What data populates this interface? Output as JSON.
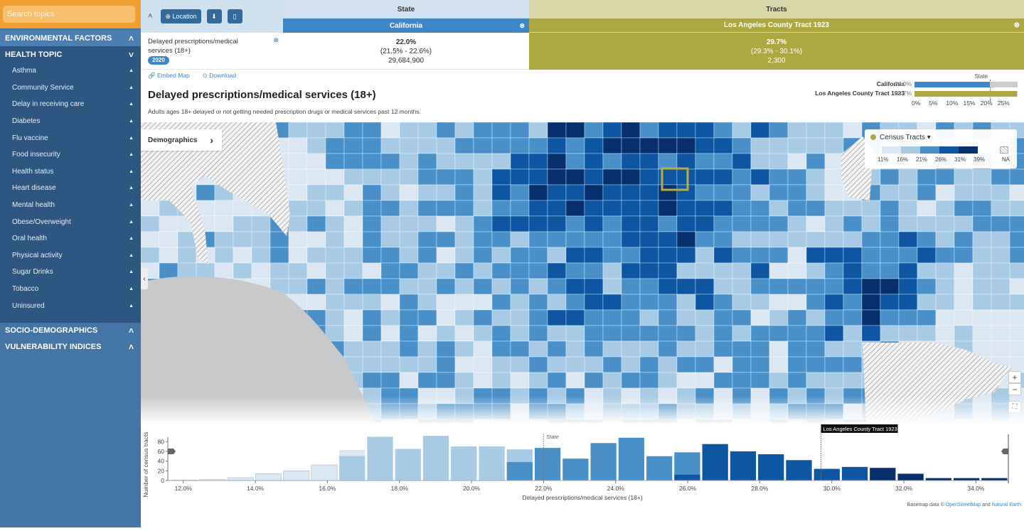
{
  "sidebar": {
    "search_placeholder": "Search topics",
    "sections": {
      "environmental": "ENVIRONMENTAL FACTORS",
      "health": "HEALTH TOPIC",
      "socio": "SOCIO-DEMOGRAPHICS",
      "vulnerability": "VULNERABILITY INDICES"
    },
    "topics": [
      "Asthma",
      "Community Service",
      "Delay in receiving care",
      "Diabetes",
      "Flu vaccine",
      "Food insecurity",
      "Health status",
      "Heart disease",
      "Mental health",
      "Obese/Overweight",
      "Oral health",
      "Physical activity",
      "Sugar Drinks",
      "Tobacco",
      "Uninsured"
    ],
    "chevron_up": "˄",
    "chevron_down": "˅"
  },
  "header": {
    "location_btn": "⊕ Location",
    "download_icon": "⬇",
    "bookmark_icon": "▯",
    "collapse_icon": "˄",
    "state_col": "State",
    "tracts_col": "Tracts",
    "state_name": "California",
    "tract_name": "Los Angeles County Tract 1923",
    "close_icon": "⊗",
    "indicator": "Delayed prescriptions/medical services (18+)",
    "year": "2020",
    "state_value": "22.0%",
    "state_ci": "(21.5% - 22.6%)",
    "state_pop": "29,684,900",
    "tract_value": "29.7%",
    "tract_ci": "(29.3% - 30.1%)",
    "tract_pop": "2,300"
  },
  "links": {
    "embed": "🔗 Embed Map",
    "download": "⊙ Download"
  },
  "title": "Delayed prescriptions/medical services (18+)",
  "subtitle": "Adults ages 18+ delayed or not getting needed prescription drugs or medical services past 12 months.",
  "comparison": {
    "state_label": "State",
    "rows": [
      {
        "name": "California",
        "value": 22.0,
        "display": "22.0%",
        "color": "#3f86c8"
      },
      {
        "name": "Los Angeles County Tract 1923",
        "value": 29.7,
        "display": "29.7%",
        "color": "#aea843"
      }
    ],
    "max": 30,
    "ticks": [
      "0%",
      "5%",
      "10%",
      "15%",
      "20%",
      "25%"
    ]
  },
  "map": {
    "demographics_btn": "Demographics",
    "chevron_right": "›",
    "collapse_left": "‹",
    "legend_title": "Census Tracts ▾",
    "legend_colors": [
      "#dbe7f3",
      "#a7cbe4",
      "#4a90c8",
      "#0e56a1",
      "#072f6b"
    ],
    "legend_ticks": [
      "11%",
      "16%",
      "21%",
      "26%",
      "31%",
      "39%"
    ],
    "legend_na": "NA",
    "zoom_in": "+",
    "zoom_out": "−",
    "fullscreen": "⛶",
    "highlight_color": "#b9ad3d"
  },
  "attribution": {
    "prefix": "Basemap data © ",
    "osm": "OpenStreetMap",
    "and": " and ",
    "ne": "Natural Earth"
  },
  "chart_data": {
    "type": "bar",
    "title": "",
    "xlabel": "Delayed prescriptions/medical services (18+)",
    "ylabel": "Number of census tracts",
    "xlim": [
      11.65,
      34.9
    ],
    "ylim": [
      0,
      95
    ],
    "x_ticks": [
      "12.0%",
      "14.0%",
      "16.0%",
      "18.0%",
      "20.0%",
      "22.0%",
      "24.0%",
      "26.0%",
      "28.0%",
      "30.0%",
      "32.0%",
      "34.0%"
    ],
    "x_tick_values": [
      12,
      14,
      16,
      18,
      20,
      22,
      24,
      26,
      28,
      30,
      32,
      34
    ],
    "y_ticks": [
      0,
      20,
      40,
      60,
      80
    ],
    "bins": 30,
    "values": [
      1,
      2,
      6,
      14,
      20,
      32,
      63,
      90,
      65,
      92,
      70,
      70,
      64,
      67,
      45,
      77,
      88,
      50,
      58,
      75,
      60,
      54,
      42,
      24,
      28,
      26,
      14,
      5,
      5,
      5
    ],
    "split_values": [
      null,
      null,
      null,
      null,
      null,
      null,
      50,
      null,
      null,
      null,
      null,
      null,
      38,
      null,
      null,
      null,
      null,
      null,
      12,
      null,
      null,
      null,
      null,
      null,
      null,
      null,
      null,
      null,
      null,
      null
    ],
    "bin_colors": [
      "#dbe7f3",
      "#dbe7f3",
      "#dbe7f3",
      "#dbe7f3",
      "#dbe7f3",
      "#dbe7f3",
      "#a7cbe4",
      "#a7cbe4",
      "#a7cbe4",
      "#a7cbe4",
      "#a7cbe4",
      "#a7cbe4",
      "#a7cbe4",
      "#4a90c8",
      "#4a90c8",
      "#4a90c8",
      "#4a90c8",
      "#4a90c8",
      "#4a90c8",
      "#0e56a1",
      "#0e56a1",
      "#0e56a1",
      "#0e56a1",
      "#0e56a1",
      "#0e56a1",
      "#072f6b",
      "#072f6b",
      "#072f6b",
      "#072f6b",
      "#072f6b"
    ],
    "split_colors": [
      null,
      null,
      null,
      null,
      null,
      null,
      "#dbe7f3",
      null,
      null,
      null,
      null,
      null,
      "#a7cbe4",
      null,
      null,
      null,
      null,
      null,
      "#4a90c8",
      null,
      null,
      null,
      null,
      null,
      null,
      null,
      null,
      null,
      null,
      null
    ],
    "split_bottom_colors": [
      null,
      null,
      null,
      null,
      null,
      null,
      "#a7cbe4",
      null,
      null,
      null,
      null,
      null,
      "#4a90c8",
      null,
      null,
      null,
      null,
      null,
      "#0e56a1",
      null,
      null,
      null,
      null,
      null,
      null,
      null,
      null,
      null,
      null,
      null
    ],
    "reference_lines": [
      {
        "label": "State",
        "x": 22.0
      },
      {
        "label": "Los Angeles County Tract 1923",
        "x": 29.7
      }
    ]
  }
}
